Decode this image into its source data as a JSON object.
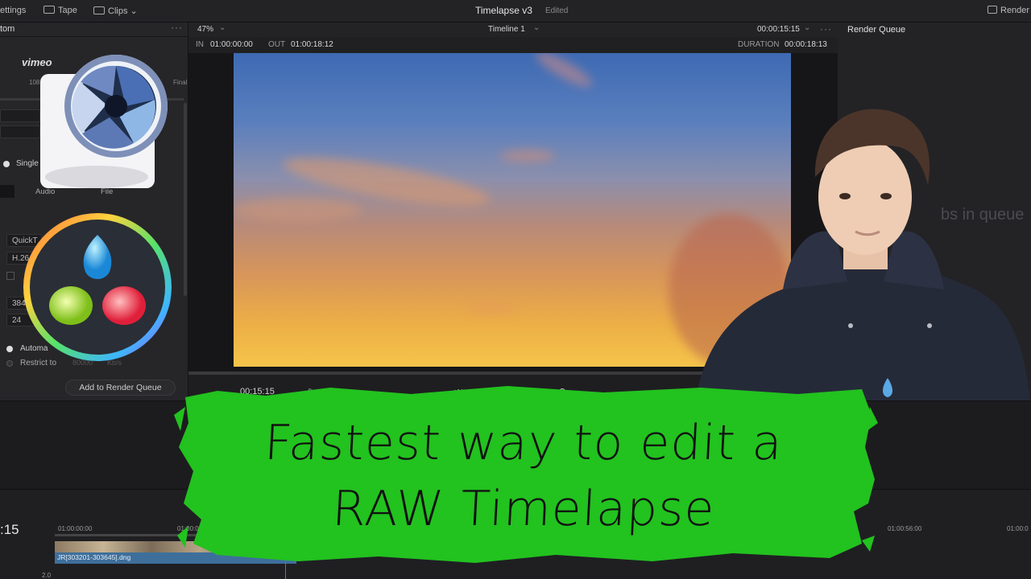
{
  "topbar": {
    "settings_label": "ettings",
    "tape_label": "Tape",
    "clips_label": "Clips",
    "project_title": "Timelapse v3",
    "project_status": "Edited",
    "render_label": "Render"
  },
  "left_panel": {
    "header_label": "tom",
    "presets": [
      "vimeo",
      "108",
      "Final"
    ],
    "single_clip_label": "Single",
    "tabs": [
      "Audio",
      "File"
    ],
    "format_value": "QuickT",
    "codec_value": "H.26",
    "resolution_value": "384",
    "framerate_value": "24",
    "quality_auto_label": "Automa",
    "restrict_label": "Restrict to",
    "restrict_value": "80000",
    "restrict_unit": "Kb/s",
    "add_to_queue_label": "Add to Render Queue"
  },
  "viewer": {
    "zoom": "47%",
    "timeline_name": "Timeline 1",
    "timecode": "00:00:15:15",
    "in_label": "IN",
    "in_value": "01:00:00:00",
    "out_label": "OUT",
    "out_value": "01:00:18:12",
    "duration_label": "DURATION",
    "duration_value": "00:00:18:13",
    "current_time": "00:15:15"
  },
  "render_queue": {
    "title": "Render Queue",
    "empty_text": "bs in queue"
  },
  "timeline": {
    "current_time": ":15",
    "ruler_labels": [
      "01:00:00:00",
      "01:00:0",
      "01:00:56:00",
      "01:00:0"
    ],
    "clip_name": "JR[303201-303645].dng",
    "track_value": "2.0"
  },
  "banner": {
    "line1": "Fastest way to edit a",
    "line2": "RAW Timelapse"
  },
  "colors": {
    "banner_green": "#22c21f",
    "accent_blue": "#3e6f9b"
  }
}
